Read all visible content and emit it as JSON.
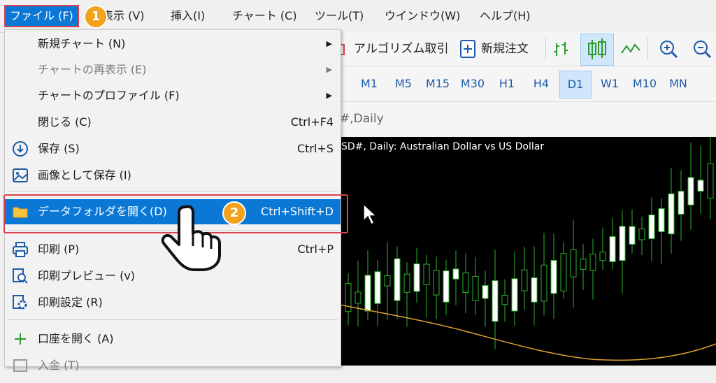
{
  "menubar": {
    "items": [
      {
        "label": "ファイル (F)"
      },
      {
        "label": "表示 (V)"
      },
      {
        "label": "挿入(I)"
      },
      {
        "label": "チャート (C)"
      },
      {
        "label": "ツール(T)"
      },
      {
        "label": "ウインドウ(W)"
      },
      {
        "label": "ヘルプ(H)"
      }
    ]
  },
  "toolbar": {
    "algo_label": "アルゴリズム取引",
    "new_order_label": "新規注文"
  },
  "timeframes": [
    "M1",
    "M5",
    "M15",
    "M30",
    "H1",
    "H4",
    "D1",
    "W1",
    "M10",
    "MN"
  ],
  "timeframe_selected": "D1",
  "chart_tab": "#,Daily",
  "chart": {
    "title": "SD#, Daily:  Australian Dollar vs US Dollar",
    "candle_color": "#2db42d",
    "ma_color": "#e0a030"
  },
  "file_menu": {
    "items": [
      {
        "label": "新規チャート (N)",
        "shortcut": ""
      },
      {
        "label": "チャートの再表示 (E)",
        "shortcut": ""
      },
      {
        "label": "チャートのプロファイル (F)",
        "shortcut": ""
      },
      {
        "label": "閉じる (C)",
        "shortcut": "Ctrl+F4"
      },
      {
        "label": "保存 (S)",
        "shortcut": "Ctrl+S"
      },
      {
        "label": "画像として保存 (I)",
        "shortcut": ""
      },
      {
        "label": "データフォルダを開く(D)",
        "shortcut": "Ctrl+Shift+D"
      },
      {
        "label": "印刷 (P)",
        "shortcut": "Ctrl+P"
      },
      {
        "label": "印刷プレビュー (v)",
        "shortcut": ""
      },
      {
        "label": "印刷設定 (R)",
        "shortcut": ""
      },
      {
        "label": "口座を開く (A)",
        "shortcut": ""
      },
      {
        "label": "入金 (T)",
        "shortcut": ""
      }
    ]
  },
  "badges": {
    "one": "1",
    "two": "2"
  },
  "colors": {
    "accent": "#0b78d6",
    "highlight_box": "#d9434e",
    "badge": "#f3a21b"
  }
}
